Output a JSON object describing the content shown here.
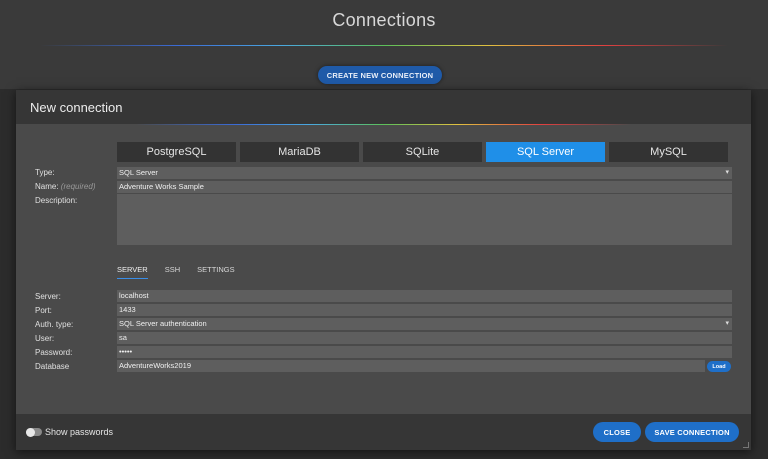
{
  "page": {
    "title": "Connections",
    "create_button": "CREATE NEW CONNECTION"
  },
  "modal": {
    "title": "New connection",
    "db_tabs": [
      {
        "label": "PostgreSQL",
        "active": false
      },
      {
        "label": "MariaDB",
        "active": false
      },
      {
        "label": "SQLite",
        "active": false
      },
      {
        "label": "SQL Server",
        "active": true
      },
      {
        "label": "MySQL",
        "active": false
      }
    ],
    "type": {
      "label": "Type:",
      "value": "SQL Server"
    },
    "name": {
      "label": "Name:",
      "required_hint": "(required)",
      "value": "Adventure Works Sample"
    },
    "description": {
      "label": "Description:",
      "value": ""
    },
    "sub_tabs": [
      {
        "label": "SERVER",
        "active": true
      },
      {
        "label": "SSH",
        "active": false
      },
      {
        "label": "SETTINGS",
        "active": false
      }
    ],
    "server": {
      "label": "Server:",
      "value": "localhost"
    },
    "port": {
      "label": "Port:",
      "value": "1433"
    },
    "auth_type": {
      "label": "Auth. type:",
      "value": "SQL Server authentication"
    },
    "user": {
      "label": "User:",
      "value": "sa"
    },
    "password": {
      "label": "Password:",
      "value": "•••••"
    },
    "database": {
      "label": "Database",
      "value": "AdventureWorks2019",
      "load_label": "Load"
    },
    "footer": {
      "show_passwords_label": "Show passwords",
      "show_passwords_on": false,
      "close_label": "CLOSE",
      "save_label": "SAVE CONNECTION"
    }
  },
  "colors": {
    "accent": "#1f8fe8",
    "button": "#1f6fc8",
    "background": "#3a3a3a",
    "modal": "#4a4a4a",
    "input": "#5e5e5e"
  }
}
